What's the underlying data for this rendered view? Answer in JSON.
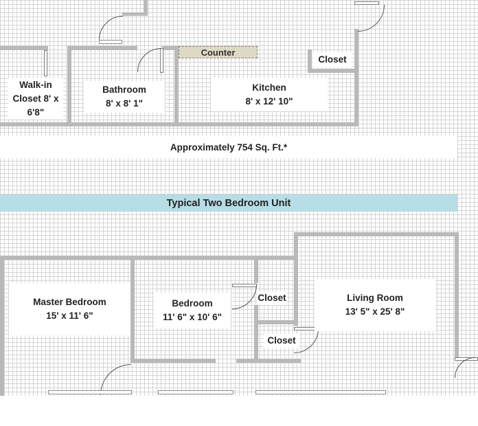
{
  "top_unit": {
    "rooms": [
      {
        "name": "Walk-in",
        "line2": "Closet  8' x",
        "line3": "6'8\""
      },
      {
        "name": "Bathroom",
        "dims": "8' x 8' 1\""
      },
      {
        "name": "Kitchen",
        "dims": "8' x 12' 10\""
      },
      {
        "name": "Closet"
      }
    ],
    "counter_label": "Counter",
    "area_note": "Approximately 754 Sq. Ft.*"
  },
  "bottom_unit": {
    "banner": "Typical Two Bedroom Unit",
    "rooms": [
      {
        "name": "Master Bedroom",
        "dims": "15' x 11' 6\""
      },
      {
        "name": "Bedroom",
        "dims": "11' 6\" x 10' 6\""
      },
      {
        "name": "Closet"
      },
      {
        "name": "Closet"
      },
      {
        "name": "Living Room",
        "dims": "13' 5\" x 25' 8\""
      }
    ]
  },
  "colors": {
    "wall": "#b9b9b9",
    "banner": "#b7dde6",
    "counter": "#ddd9c4",
    "grid": "#d4d4d4"
  }
}
